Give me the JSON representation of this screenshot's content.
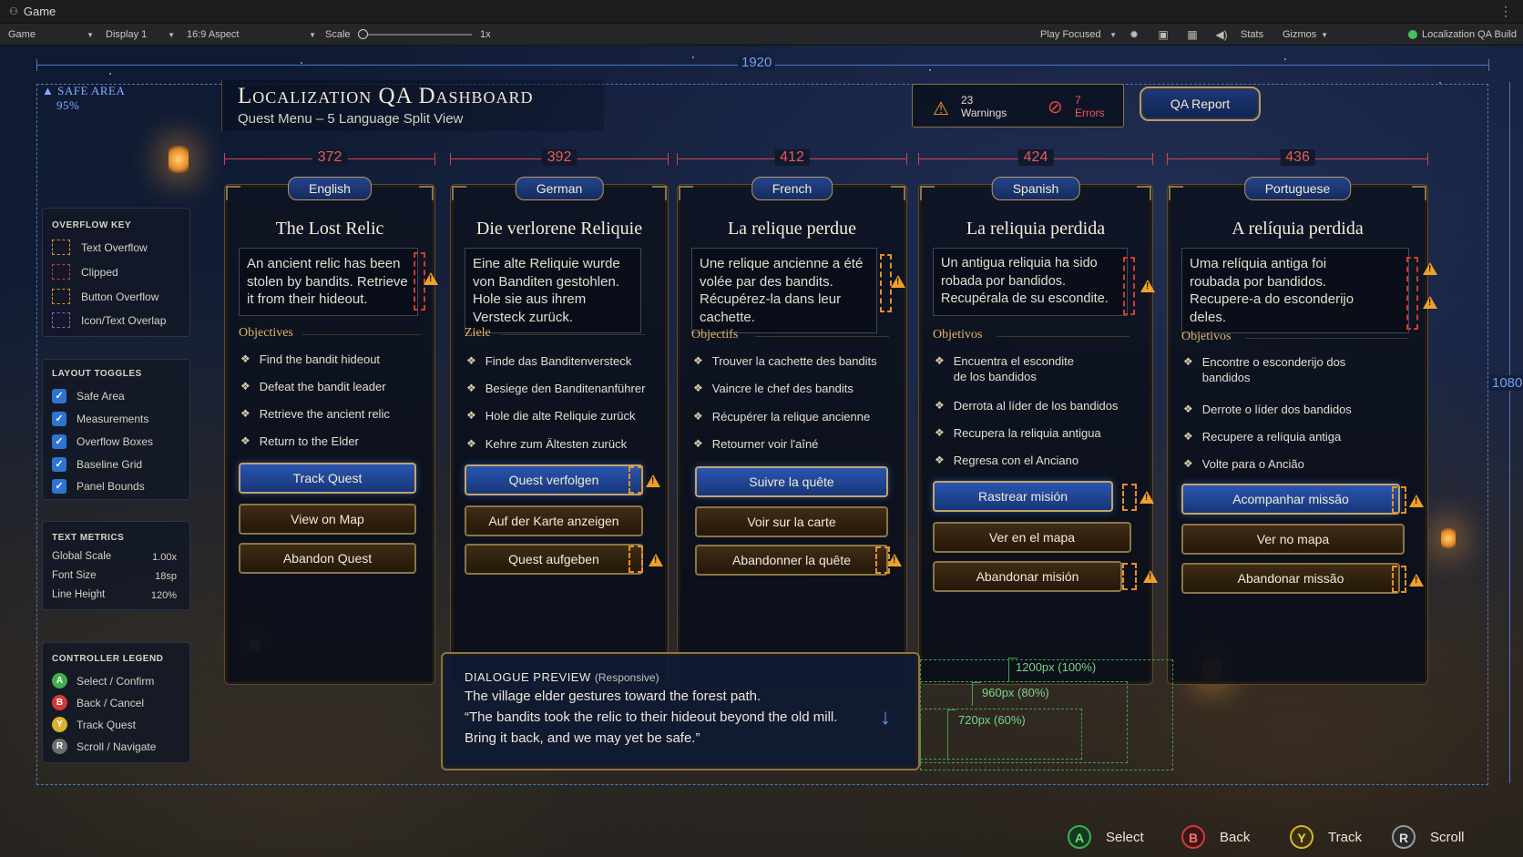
{
  "editor": {
    "window_title": "Game",
    "view_dropdown": "Game",
    "display_dropdown": "Display 1",
    "aspect_dropdown": "16:9 Aspect",
    "scale_label": "Scale",
    "scale_value": "1x",
    "play_mode": "Play Focused",
    "stats_label": "Stats",
    "gizmos_label": "Gizmos",
    "build_status": "Localization QA Build",
    "build_status_color": "#43c35a"
  },
  "overlay": {
    "width_label": "1920",
    "height_label": "1080",
    "safe_area_label": "SAFE AREA",
    "safe_area_value": "95%"
  },
  "header": {
    "title": "Localization QA Dashboard",
    "subtitle": "Quest Menu – 5 Language Split View",
    "warnings_count": "23",
    "warnings_label": "Warnings",
    "errors_count": "7",
    "errors_label": "Errors",
    "qa_report_label": "QA Report"
  },
  "overflow_key": {
    "title": "OVERFLOW KEY",
    "items": [
      {
        "label": "Text Overflow",
        "color": "#e6902a"
      },
      {
        "label": "Clipped",
        "color": "#d03a30"
      },
      {
        "label": "Button Overflow",
        "color": "#e6902a"
      },
      {
        "label": "Icon/Text Overlap",
        "color": "#8a5ae0"
      }
    ]
  },
  "layout_toggles": {
    "title": "LAYOUT TOGGLES",
    "items": [
      {
        "label": "Safe Area",
        "checked": true
      },
      {
        "label": "Measurements",
        "checked": true
      },
      {
        "label": "Overflow Boxes",
        "checked": true
      },
      {
        "label": "Baseline Grid",
        "checked": true
      },
      {
        "label": "Panel Bounds",
        "checked": true
      }
    ]
  },
  "text_metrics": {
    "title": "TEXT METRICS",
    "rows": [
      {
        "label": "Global Scale",
        "value": "1.00x"
      },
      {
        "label": "Font Size",
        "value": "18sp"
      },
      {
        "label": "Line Height",
        "value": "120%"
      }
    ]
  },
  "controller_legend": {
    "title": "CONTROLLER LEGEND",
    "items": [
      {
        "button": "A",
        "label": "Select / Confirm",
        "color": "#3fae4a"
      },
      {
        "button": "B",
        "label": "Back / Cancel",
        "color": "#d23a3a"
      },
      {
        "button": "Y",
        "label": "Track Quest",
        "color": "#d8b230"
      },
      {
        "button": "R",
        "label": "Scroll / Navigate",
        "color": "#7a7a7a"
      }
    ]
  },
  "columns": [
    {
      "width_value": "372",
      "language": "English",
      "quest_title": "The Lost Relic",
      "description": [
        "An ancient relic has been",
        "stolen by bandits. Retrieve",
        "it from their hideout."
      ],
      "objectives_label": "Objectives",
      "objectives": [
        [
          "Find the bandit hideout"
        ],
        [
          "Defeat the bandit leader"
        ],
        [
          "Retrieve the ancient relic"
        ],
        [
          "Return to the Elder"
        ]
      ],
      "buttons": [
        "Track Quest",
        "View on Map",
        "Abandon Quest"
      ]
    },
    {
      "width_value": "392",
      "language": "German",
      "quest_title": "Die verlorene Reliquie",
      "description": [
        "Eine alte Reliquie wurde",
        "von Banditen gestohlen.",
        "Hole sie aus ihrem",
        "Versteck zurück."
      ],
      "objectives_label": "Ziele",
      "objectives": [
        [
          "Finde das Banditenversteck"
        ],
        [
          "Besiege den Banditenanführer"
        ],
        [
          "Hole die alte Reliquie zurück"
        ],
        [
          "Kehre zum Ältesten zurück"
        ]
      ],
      "buttons": [
        "Quest verfolgen",
        "Auf der Karte anzeigen",
        "Quest aufgeben"
      ]
    },
    {
      "width_value": "412",
      "language": "French",
      "quest_title": "La relique perdue",
      "description": [
        "Une relique ancienne a été",
        "volée par des bandits.",
        "Récupérez-la dans leur",
        "cachette."
      ],
      "objectives_label": "Objectifs",
      "objectives": [
        [
          "Trouver la cachette des bandits"
        ],
        [
          "Vaincre le chef des bandits"
        ],
        [
          "Récupérer la relique ancienne"
        ],
        [
          "Retourner voir l'aîné"
        ]
      ],
      "buttons": [
        "Suivre la quête",
        "Voir sur la carte",
        "Abandonner la quête"
      ]
    },
    {
      "width_value": "424",
      "language": "Spanish",
      "quest_title": "La reliquia perdida",
      "description": [
        "Un antigua reliquia ha sido",
        "robada por bandidos.",
        "Recupérala de su escondite."
      ],
      "objectives_label": "Objetivos",
      "objectives": [
        [
          "Encuentra el escondite",
          "de los bandidos"
        ],
        [
          "Derrota al líder de los bandidos"
        ],
        [
          "Recupera la reliquia antigua"
        ],
        [
          "Regresa con el Anciano"
        ]
      ],
      "buttons": [
        "Rastrear misión",
        "Ver en el mapa",
        "Abandonar misión"
      ]
    },
    {
      "width_value": "436",
      "language": "Portuguese",
      "quest_title": "A relíquia perdida",
      "description": [
        "Uma relíquia antiga foi",
        "roubada por bandidos.",
        "Recupere-a do esconderijo",
        "deles."
      ],
      "objectives_label": "Objetivos",
      "objectives": [
        [
          "Encontre o esconderijo dos",
          "bandidos"
        ],
        [
          "Derrote o líder dos bandidos"
        ],
        [
          "Recupere a relíquia antiga"
        ],
        [
          "Volte para o Ancião"
        ]
      ],
      "buttons": [
        "Acompanhar missão",
        "Ver no mapa",
        "Abandonar missão"
      ]
    }
  ],
  "dialogue": {
    "heading": "DIALOGUE PREVIEW",
    "heading_note": "(Responsive)",
    "line1": "The village elder gestures toward the forest path.",
    "line2": "“The bandits took the relic to their hideout beyond the old mill.",
    "line3": "Bring it back, and we may yet be safe.”",
    "widths": [
      "1200px (100%)",
      "960px (80%)",
      "720px (60%)"
    ]
  },
  "hints": [
    {
      "button": "A",
      "label": "Select",
      "color": "#3fae4a"
    },
    {
      "button": "B",
      "label": "Back",
      "color": "#d23a3a"
    },
    {
      "button": "Y",
      "label": "Track",
      "color": "#d8b230"
    },
    {
      "button": "R",
      "label": "Scroll",
      "color": "#9a9a9a"
    }
  ]
}
